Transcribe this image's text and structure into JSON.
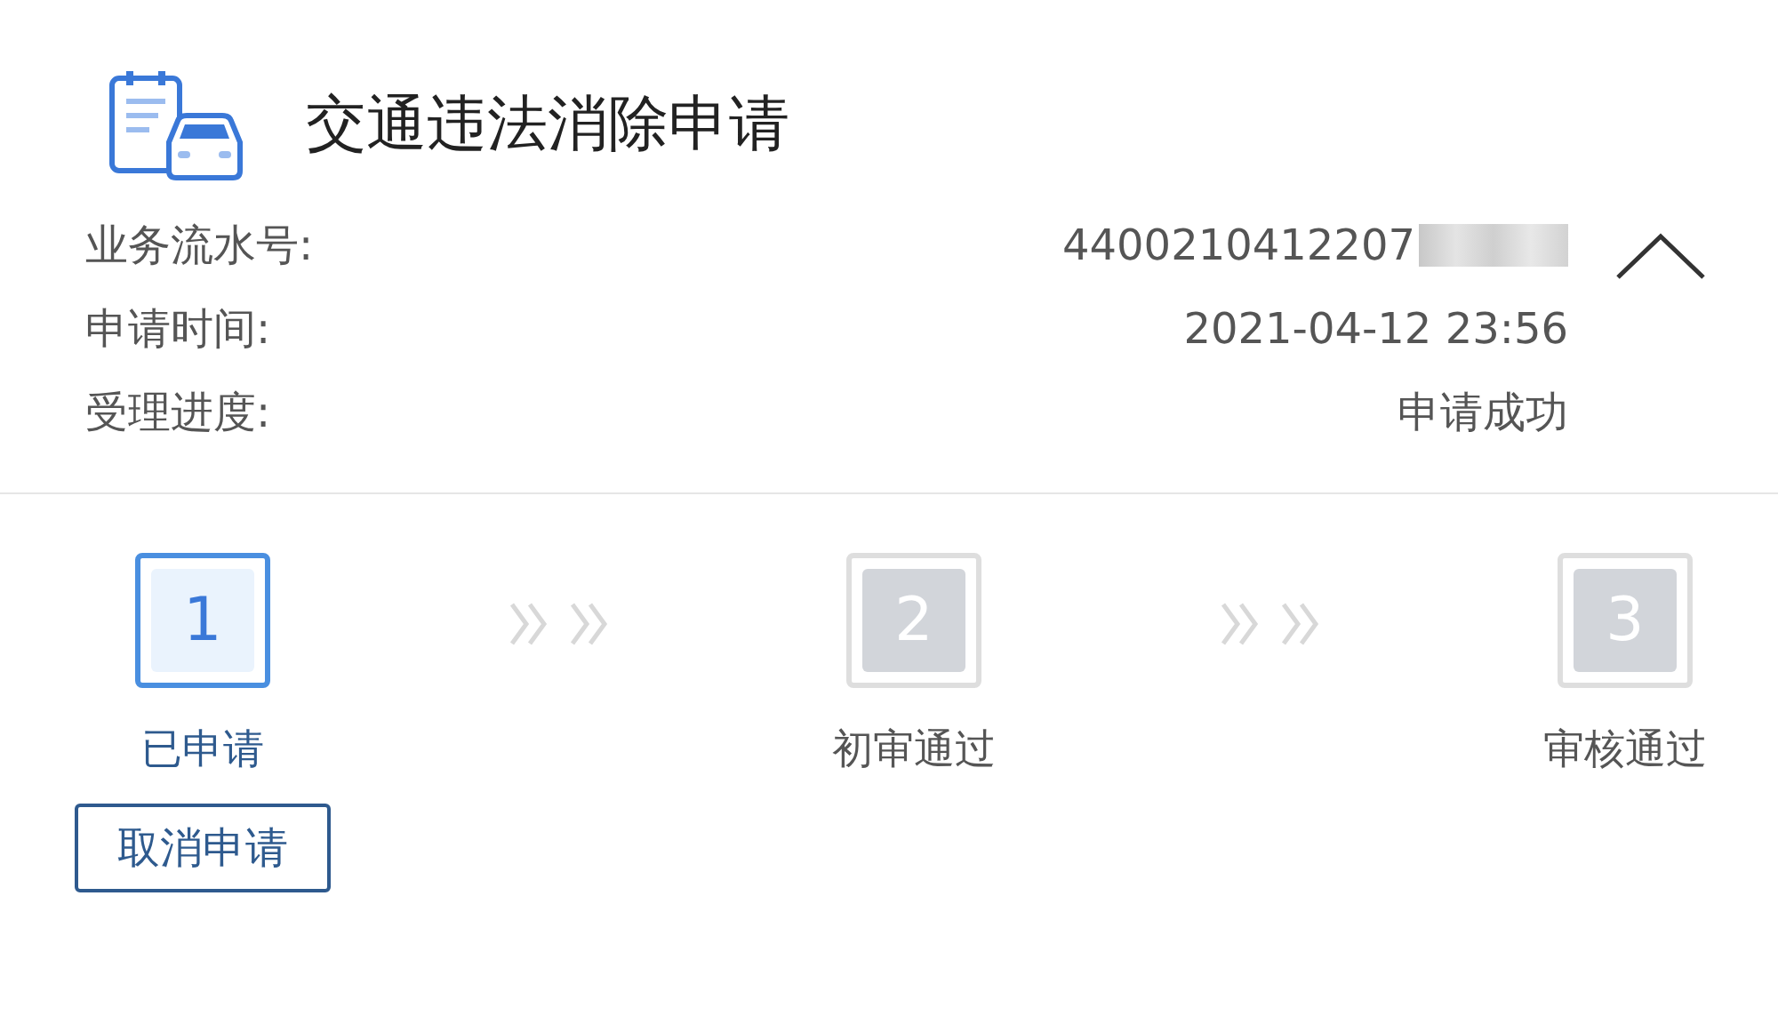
{
  "title": "交通违法消除申请",
  "details": {
    "expanded": true,
    "rows": [
      {
        "label": "业务流水号:",
        "value": "4400210412207",
        "redacted": true
      },
      {
        "label": "申请时间:",
        "value": "2021-04-12 23:56",
        "redacted": false
      },
      {
        "label": "受理进度:",
        "value": "申请成功",
        "redacted": false
      }
    ]
  },
  "steps": [
    {
      "number": "1",
      "label": "已申请",
      "selected": true
    },
    {
      "number": "2",
      "label": "初审通过",
      "selected": false
    },
    {
      "number": "3",
      "label": "审核通过",
      "selected": false
    }
  ],
  "cancel_button": "取消申请"
}
